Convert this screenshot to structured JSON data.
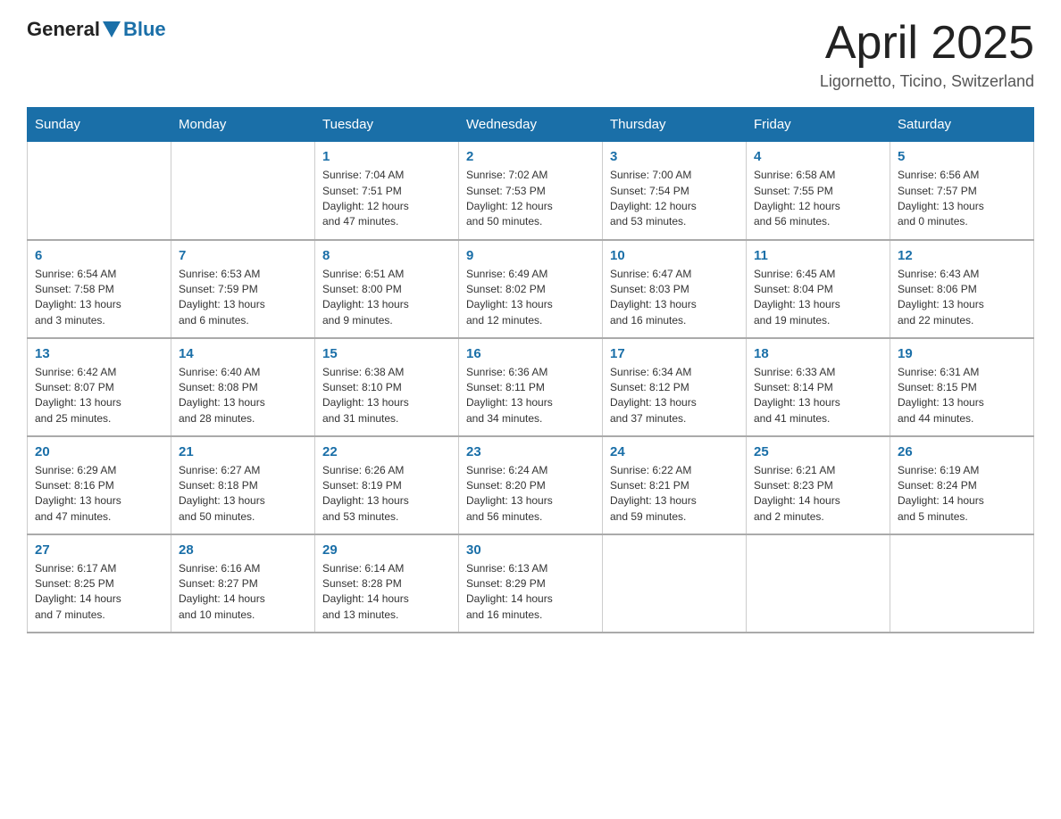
{
  "header": {
    "logo_general": "General",
    "logo_blue": "Blue",
    "month_title": "April 2025",
    "location": "Ligornetto, Ticino, Switzerland"
  },
  "weekdays": [
    "Sunday",
    "Monday",
    "Tuesday",
    "Wednesday",
    "Thursday",
    "Friday",
    "Saturday"
  ],
  "weeks": [
    [
      {
        "num": "",
        "info": ""
      },
      {
        "num": "",
        "info": ""
      },
      {
        "num": "1",
        "info": "Sunrise: 7:04 AM\nSunset: 7:51 PM\nDaylight: 12 hours\nand 47 minutes."
      },
      {
        "num": "2",
        "info": "Sunrise: 7:02 AM\nSunset: 7:53 PM\nDaylight: 12 hours\nand 50 minutes."
      },
      {
        "num": "3",
        "info": "Sunrise: 7:00 AM\nSunset: 7:54 PM\nDaylight: 12 hours\nand 53 minutes."
      },
      {
        "num": "4",
        "info": "Sunrise: 6:58 AM\nSunset: 7:55 PM\nDaylight: 12 hours\nand 56 minutes."
      },
      {
        "num": "5",
        "info": "Sunrise: 6:56 AM\nSunset: 7:57 PM\nDaylight: 13 hours\nand 0 minutes."
      }
    ],
    [
      {
        "num": "6",
        "info": "Sunrise: 6:54 AM\nSunset: 7:58 PM\nDaylight: 13 hours\nand 3 minutes."
      },
      {
        "num": "7",
        "info": "Sunrise: 6:53 AM\nSunset: 7:59 PM\nDaylight: 13 hours\nand 6 minutes."
      },
      {
        "num": "8",
        "info": "Sunrise: 6:51 AM\nSunset: 8:00 PM\nDaylight: 13 hours\nand 9 minutes."
      },
      {
        "num": "9",
        "info": "Sunrise: 6:49 AM\nSunset: 8:02 PM\nDaylight: 13 hours\nand 12 minutes."
      },
      {
        "num": "10",
        "info": "Sunrise: 6:47 AM\nSunset: 8:03 PM\nDaylight: 13 hours\nand 16 minutes."
      },
      {
        "num": "11",
        "info": "Sunrise: 6:45 AM\nSunset: 8:04 PM\nDaylight: 13 hours\nand 19 minutes."
      },
      {
        "num": "12",
        "info": "Sunrise: 6:43 AM\nSunset: 8:06 PM\nDaylight: 13 hours\nand 22 minutes."
      }
    ],
    [
      {
        "num": "13",
        "info": "Sunrise: 6:42 AM\nSunset: 8:07 PM\nDaylight: 13 hours\nand 25 minutes."
      },
      {
        "num": "14",
        "info": "Sunrise: 6:40 AM\nSunset: 8:08 PM\nDaylight: 13 hours\nand 28 minutes."
      },
      {
        "num": "15",
        "info": "Sunrise: 6:38 AM\nSunset: 8:10 PM\nDaylight: 13 hours\nand 31 minutes."
      },
      {
        "num": "16",
        "info": "Sunrise: 6:36 AM\nSunset: 8:11 PM\nDaylight: 13 hours\nand 34 minutes."
      },
      {
        "num": "17",
        "info": "Sunrise: 6:34 AM\nSunset: 8:12 PM\nDaylight: 13 hours\nand 37 minutes."
      },
      {
        "num": "18",
        "info": "Sunrise: 6:33 AM\nSunset: 8:14 PM\nDaylight: 13 hours\nand 41 minutes."
      },
      {
        "num": "19",
        "info": "Sunrise: 6:31 AM\nSunset: 8:15 PM\nDaylight: 13 hours\nand 44 minutes."
      }
    ],
    [
      {
        "num": "20",
        "info": "Sunrise: 6:29 AM\nSunset: 8:16 PM\nDaylight: 13 hours\nand 47 minutes."
      },
      {
        "num": "21",
        "info": "Sunrise: 6:27 AM\nSunset: 8:18 PM\nDaylight: 13 hours\nand 50 minutes."
      },
      {
        "num": "22",
        "info": "Sunrise: 6:26 AM\nSunset: 8:19 PM\nDaylight: 13 hours\nand 53 minutes."
      },
      {
        "num": "23",
        "info": "Sunrise: 6:24 AM\nSunset: 8:20 PM\nDaylight: 13 hours\nand 56 minutes."
      },
      {
        "num": "24",
        "info": "Sunrise: 6:22 AM\nSunset: 8:21 PM\nDaylight: 13 hours\nand 59 minutes."
      },
      {
        "num": "25",
        "info": "Sunrise: 6:21 AM\nSunset: 8:23 PM\nDaylight: 14 hours\nand 2 minutes."
      },
      {
        "num": "26",
        "info": "Sunrise: 6:19 AM\nSunset: 8:24 PM\nDaylight: 14 hours\nand 5 minutes."
      }
    ],
    [
      {
        "num": "27",
        "info": "Sunrise: 6:17 AM\nSunset: 8:25 PM\nDaylight: 14 hours\nand 7 minutes."
      },
      {
        "num": "28",
        "info": "Sunrise: 6:16 AM\nSunset: 8:27 PM\nDaylight: 14 hours\nand 10 minutes."
      },
      {
        "num": "29",
        "info": "Sunrise: 6:14 AM\nSunset: 8:28 PM\nDaylight: 14 hours\nand 13 minutes."
      },
      {
        "num": "30",
        "info": "Sunrise: 6:13 AM\nSunset: 8:29 PM\nDaylight: 14 hours\nand 16 minutes."
      },
      {
        "num": "",
        "info": ""
      },
      {
        "num": "",
        "info": ""
      },
      {
        "num": "",
        "info": ""
      }
    ]
  ]
}
